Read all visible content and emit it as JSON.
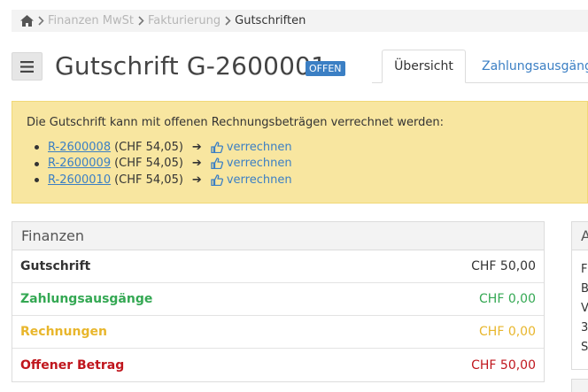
{
  "breadcrumb": {
    "items": [
      {
        "label": "Finanzen MwSt"
      },
      {
        "label": "Fakturierung"
      },
      {
        "label": "Gutschriften"
      }
    ]
  },
  "header": {
    "title": "Gutschrift G-2600001",
    "status": "OFFEN"
  },
  "tabs": [
    {
      "label": "Übersicht",
      "active": true
    },
    {
      "label": "Zahlungsausgänge",
      "active": false
    }
  ],
  "notice": {
    "text": "Die Gutschrift kann mit offenen Rechnungsbeträgen verrechnet werden:",
    "items": [
      {
        "invoice": "R-2600008",
        "amount": "(CHF 54,05)",
        "action": "verrechnen"
      },
      {
        "invoice": "R-2600009",
        "amount": "(CHF 54,05)",
        "action": "verrechnen"
      },
      {
        "invoice": "R-2600010",
        "amount": "(CHF 54,05)",
        "action": "verrechnen"
      }
    ],
    "arrow": "➔"
  },
  "finance_panel": {
    "title": "Finanzen",
    "rows": [
      {
        "label": "Gutschrift",
        "value": "CHF 50,00",
        "color": "#333333"
      },
      {
        "label": "Zahlungsausgänge",
        "value": "CHF 0,00",
        "color": "#34a853"
      },
      {
        "label": "Rechnungen",
        "value": "CHF 0,00",
        "color": "#e8b62c"
      },
      {
        "label": "Offener Betrag",
        "value": "CHF 50,00",
        "color": "#c0161d"
      }
    ]
  },
  "side_panel": {
    "title": "A",
    "lines": [
      "F",
      "B",
      "V",
      "3",
      "S"
    ]
  },
  "colors": {
    "accent": "#3b7fc4",
    "notice_bg": "#f8e6a0"
  },
  "icons": {
    "home": "home-icon",
    "separator": "chevron-right-icon",
    "menu": "hamburger-icon",
    "action": "thumbs-up-icon"
  }
}
